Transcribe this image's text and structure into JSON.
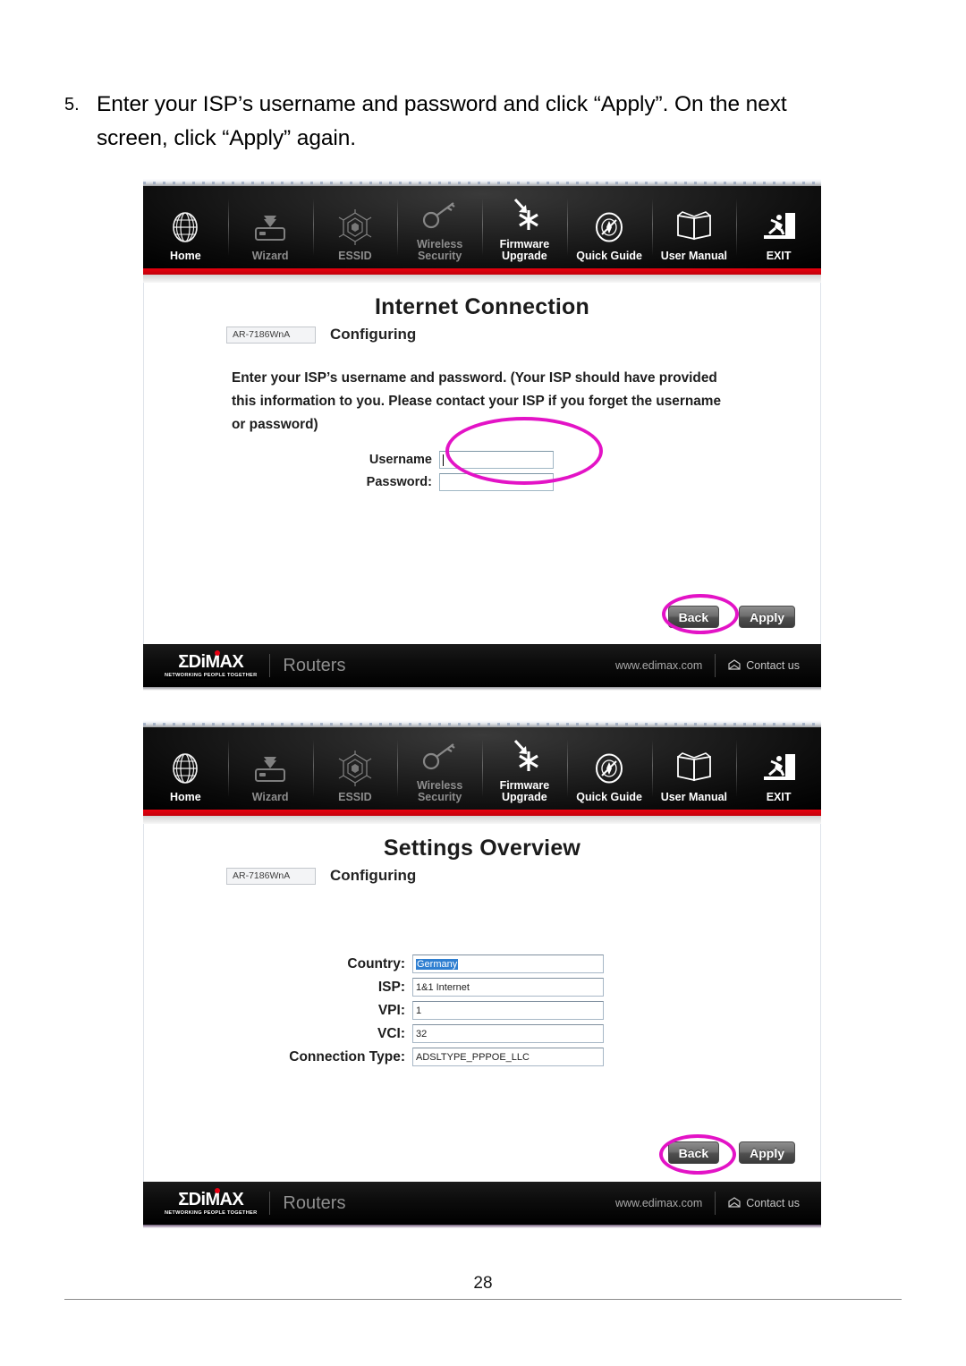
{
  "document": {
    "step_number": "5.",
    "instruction_line1": "Enter your ISP’s username and password and click “Apply”. On the next",
    "instruction_line2": "screen, click “Apply” again.",
    "page_number": "28"
  },
  "colors": {
    "annotation_magenta": "#e313c6",
    "brand_red": "#e60012",
    "nav_red_rule": "#e8000e",
    "selection_blue": "#2f7fd1"
  },
  "navbar": {
    "items": [
      {
        "label": "Home",
        "icon": "globe-icon",
        "state": "active"
      },
      {
        "label": "Wizard",
        "icon": "router-download-icon",
        "state": "dim"
      },
      {
        "label": "ESSID",
        "icon": "hexagon-web-icon",
        "state": "dim"
      },
      {
        "label": "Wireless\nSecurity",
        "icon": "key-icon",
        "state": "dim"
      },
      {
        "label": "Firmware\nUpgrade",
        "icon": "arrow-asterisk-icon",
        "state": "active"
      },
      {
        "label": "Quick Guide",
        "icon": "compass-icon",
        "state": "active"
      },
      {
        "label": "User Manual",
        "icon": "open-book-icon",
        "state": "active"
      },
      {
        "label": "EXIT",
        "icon": "exit-runner-icon",
        "state": "active"
      }
    ]
  },
  "footer": {
    "brand": "ΣDiMAX",
    "brand_tagline": "NETWORKING PEOPLE TOGETHER",
    "category": "Routers",
    "url": "www.edimax.com",
    "contact": "Contact us",
    "contact_icon": "mail-icon"
  },
  "screen_internet_connection": {
    "title": "Internet Connection",
    "model": "AR-7186WnA",
    "status": "Configuring",
    "body_line1": "Enter your ISP’s username and password. (Your ISP should have provided",
    "body_line2": "this information to you. Please contact your ISP if you forget the username",
    "body_line3": "or password)",
    "fields": [
      {
        "label": "Username",
        "value": ""
      },
      {
        "label": "Password:",
        "value": ""
      }
    ],
    "buttons": {
      "back": "Back",
      "apply": "Apply"
    }
  },
  "screen_settings_overview": {
    "title": "Settings Overview",
    "model": "AR-7186WnA",
    "status": "Configuring",
    "fields": [
      {
        "label": "Country:",
        "value": "Germany",
        "selected": true
      },
      {
        "label": "ISP:",
        "value": "1&1 Internet",
        "selected": false
      },
      {
        "label": "VPI:",
        "value": "1",
        "selected": false
      },
      {
        "label": "VCI:",
        "value": "32",
        "selected": false
      },
      {
        "label": "Connection Type:",
        "value": "ADSLTYPE_PPPOE_LLC",
        "selected": false
      }
    ],
    "buttons": {
      "back": "Back",
      "apply": "Apply"
    }
  },
  "annotations": [
    {
      "name": "credentials-highlight",
      "shape": "ellipse"
    },
    {
      "name": "apply-highlight-1",
      "shape": "ellipse"
    },
    {
      "name": "apply-highlight-2",
      "shape": "ellipse"
    }
  ]
}
